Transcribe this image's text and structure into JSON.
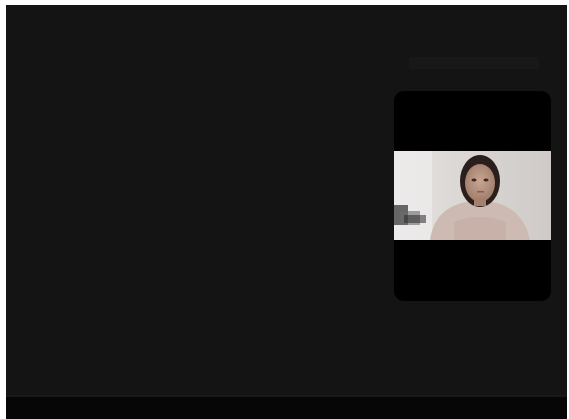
{
  "meeting": {
    "main_stage": {
      "state": "empty",
      "background": "#141414"
    },
    "self_view": {
      "icon": "participant-video",
      "background": "#000000",
      "feed_colors": {
        "wall": "#dcd9d7",
        "shirt": "#cfbcb5",
        "hair": "#2b1f1c",
        "skin": "#b48f7c"
      }
    },
    "toolbar": {
      "background": "#060606"
    }
  }
}
